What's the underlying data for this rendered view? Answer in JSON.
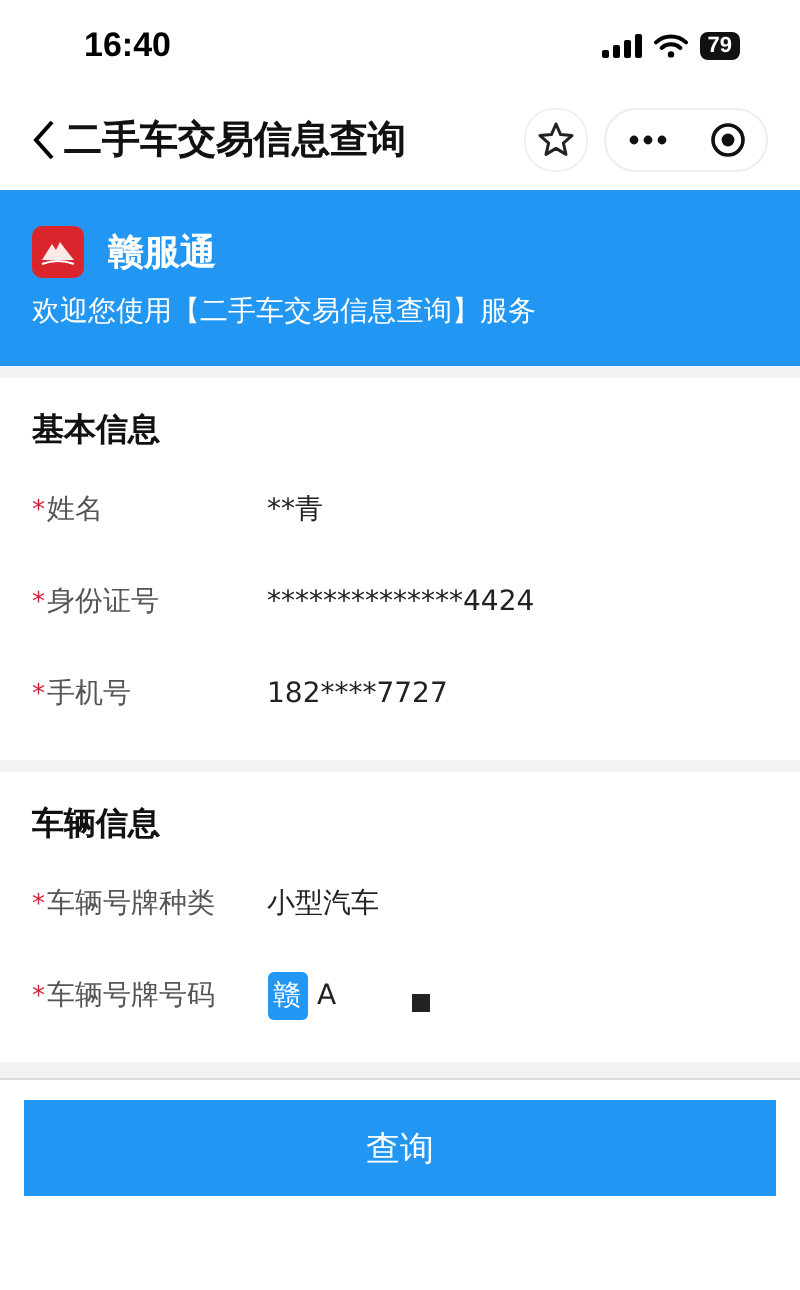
{
  "status_bar": {
    "time": "16:40",
    "battery": "79"
  },
  "nav": {
    "title": "二手车交易信息查询"
  },
  "banner": {
    "app_name": "赣服通",
    "welcome": "欢迎您使用【二手车交易信息查询】服务"
  },
  "sections": [
    {
      "title": "基本信息",
      "fields": [
        {
          "kind": "text",
          "required_mark": "*",
          "label": "姓名",
          "value": "**青"
        },
        {
          "kind": "text",
          "required_mark": "*",
          "label": "身份证号",
          "value": "**************4424"
        },
        {
          "kind": "text",
          "required_mark": "*",
          "label": "手机号",
          "value": "182****7727"
        }
      ]
    },
    {
      "title": "车辆信息",
      "fields": [
        {
          "kind": "text",
          "required_mark": "*",
          "label": "车辆号牌种类",
          "value": "小型汽车"
        },
        {
          "kind": "plate",
          "required_mark": "*",
          "label": "车辆号牌号码",
          "prefix": "赣",
          "value": "A"
        }
      ]
    }
  ],
  "button": "查询"
}
